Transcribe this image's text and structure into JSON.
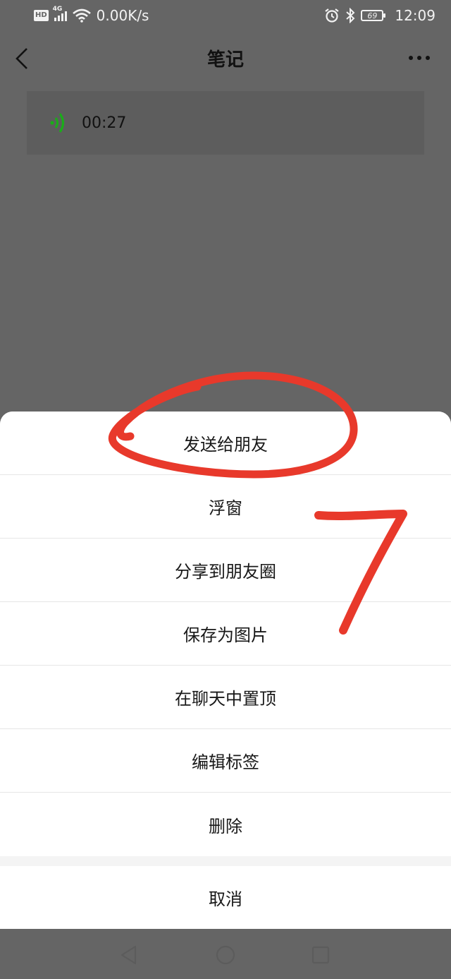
{
  "status_bar": {
    "hd": "HD",
    "network": "4G",
    "speed": "0.00K/s",
    "battery": "69",
    "time": "12:09"
  },
  "nav": {
    "title": "笔记"
  },
  "voice": {
    "duration": "00:27",
    "color": "#1aad19"
  },
  "sheet": {
    "items": [
      {
        "label": "发送给朋友"
      },
      {
        "label": "浮窗"
      },
      {
        "label": "分享到朋友圈"
      },
      {
        "label": "保存为图片"
      },
      {
        "label": "在聊天中置顶"
      },
      {
        "label": "编辑标签"
      },
      {
        "label": "删除"
      }
    ],
    "cancel": "取消"
  },
  "annotation": {
    "color": "#e8392b",
    "shape": "circle-around-first-item",
    "handwritten_number": "7"
  }
}
